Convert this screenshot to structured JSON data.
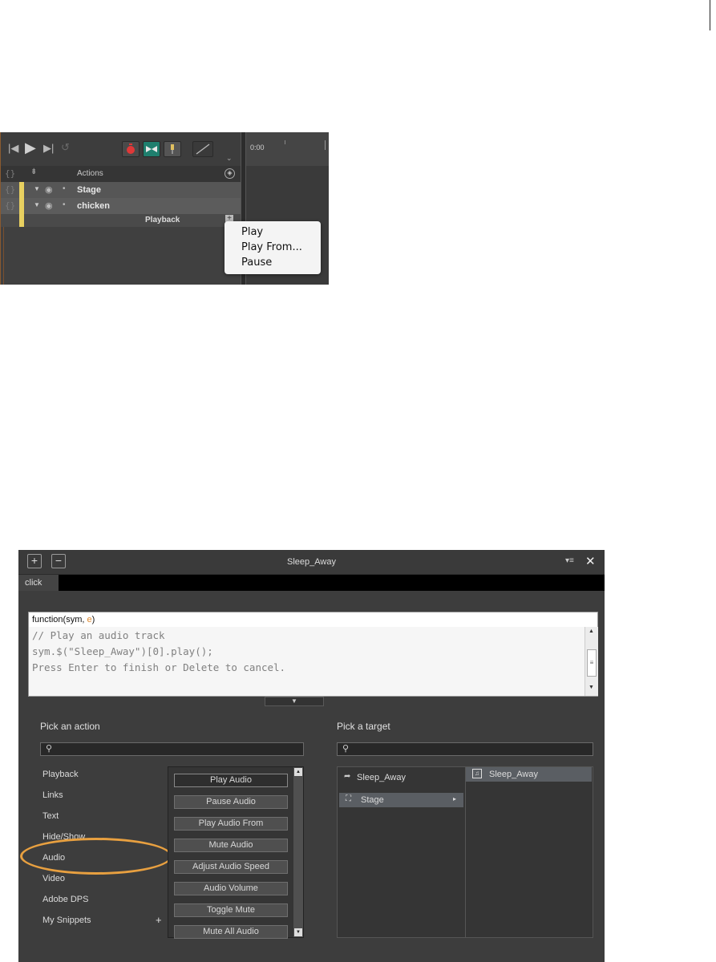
{
  "timeline": {
    "ruler_time": "0:00",
    "actions_header": "Actions",
    "rows": [
      {
        "label": "Stage"
      },
      {
        "label": "chicken"
      }
    ],
    "playback_label": "Playback",
    "context_menu": [
      "Play",
      "Play From...",
      "Pause"
    ],
    "braces_glyph": "{}",
    "add_glyph": "+"
  },
  "dialog": {
    "title": "Sleep_Away",
    "plus_label": "+",
    "minus_label": "−",
    "close_label": "✕",
    "menu_glyph": "▾≡",
    "tab_label": "click",
    "code": {
      "signature_prefix": "function(sym, ",
      "signature_param": "e",
      "signature_suffix": ")",
      "lines": [
        "// Play an audio track",
        "sym.$(\"Sleep_Away\")[0].play();",
        "Press Enter to finish or Delete to cancel."
      ]
    },
    "pick_action_label": "Pick an action",
    "pick_target_label": "Pick a target",
    "categories": [
      "Playback",
      "Links",
      "Text",
      "Hide/Show",
      "Audio",
      "Video",
      "Adobe DPS",
      "My Snippets"
    ],
    "snippets_add": "+",
    "actions": [
      "Play Audio",
      "Pause Audio",
      "Play Audio From",
      "Mute Audio",
      "Adjust Audio Speed",
      "Audio Volume",
      "Toggle Mute",
      "Mute All Audio"
    ],
    "targets": {
      "left": [
        "Sleep_Away",
        "Stage"
      ],
      "right": [
        "Sleep_Away"
      ]
    },
    "colors": {
      "highlight_ring": "#e8a040",
      "panel_bg": "#3d3d3d",
      "selection": "#5a5e63"
    }
  }
}
